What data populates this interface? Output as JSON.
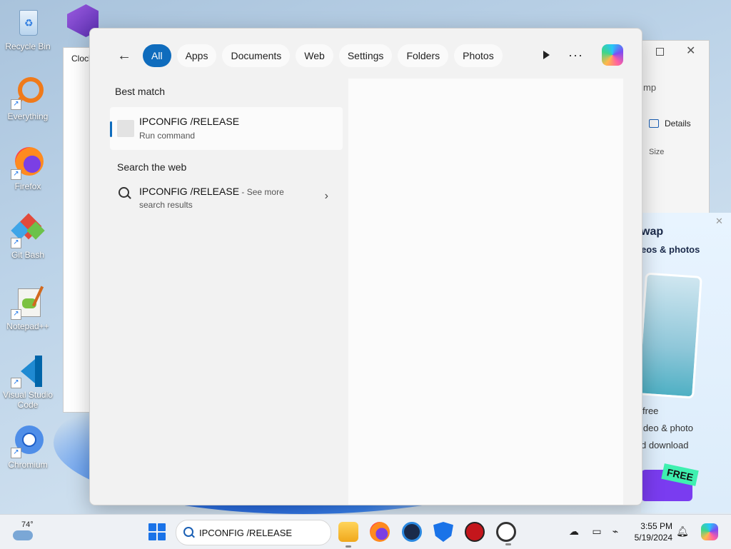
{
  "desktop": {
    "icons": [
      {
        "label": "Recycle Bin"
      },
      {
        "label": "Everything"
      },
      {
        "label": "Firefox"
      },
      {
        "label": "Git Bash"
      },
      {
        "label": "Notepad++"
      },
      {
        "label": "Visual Studio Code"
      },
      {
        "label": "Chromium"
      }
    ]
  },
  "background_windows": {
    "clock_title": "Clock",
    "explorer": {
      "partial_text": "mp",
      "details_label": "Details",
      "size_header": "Size"
    },
    "ad": {
      "title_partial": "wap",
      "subtitle_partial": "eos & photos",
      "line1": "free",
      "line2": "ideo & photo",
      "line3": "d download",
      "badge": "FREE"
    }
  },
  "search_flyout": {
    "filters": [
      "All",
      "Apps",
      "Documents",
      "Web",
      "Settings",
      "Folders",
      "Photos"
    ],
    "active_filter": "All",
    "best_match_heading": "Best match",
    "best_match": {
      "title": "IPCONFIG /RELEASE",
      "subtitle": "Run command"
    },
    "web_heading": "Search the web",
    "web_result": {
      "query": "IPCONFIG /RELEASE",
      "see_more": " - See more",
      "subtitle": "search results"
    }
  },
  "taskbar": {
    "weather_temp": "74°",
    "search_value": "IPCONFIG /RELEASE",
    "time": "3:55 PM",
    "date": "5/19/2024"
  },
  "colors": {
    "accent": "#0f6cbd",
    "taskbar_bg": "#eef1f5"
  }
}
